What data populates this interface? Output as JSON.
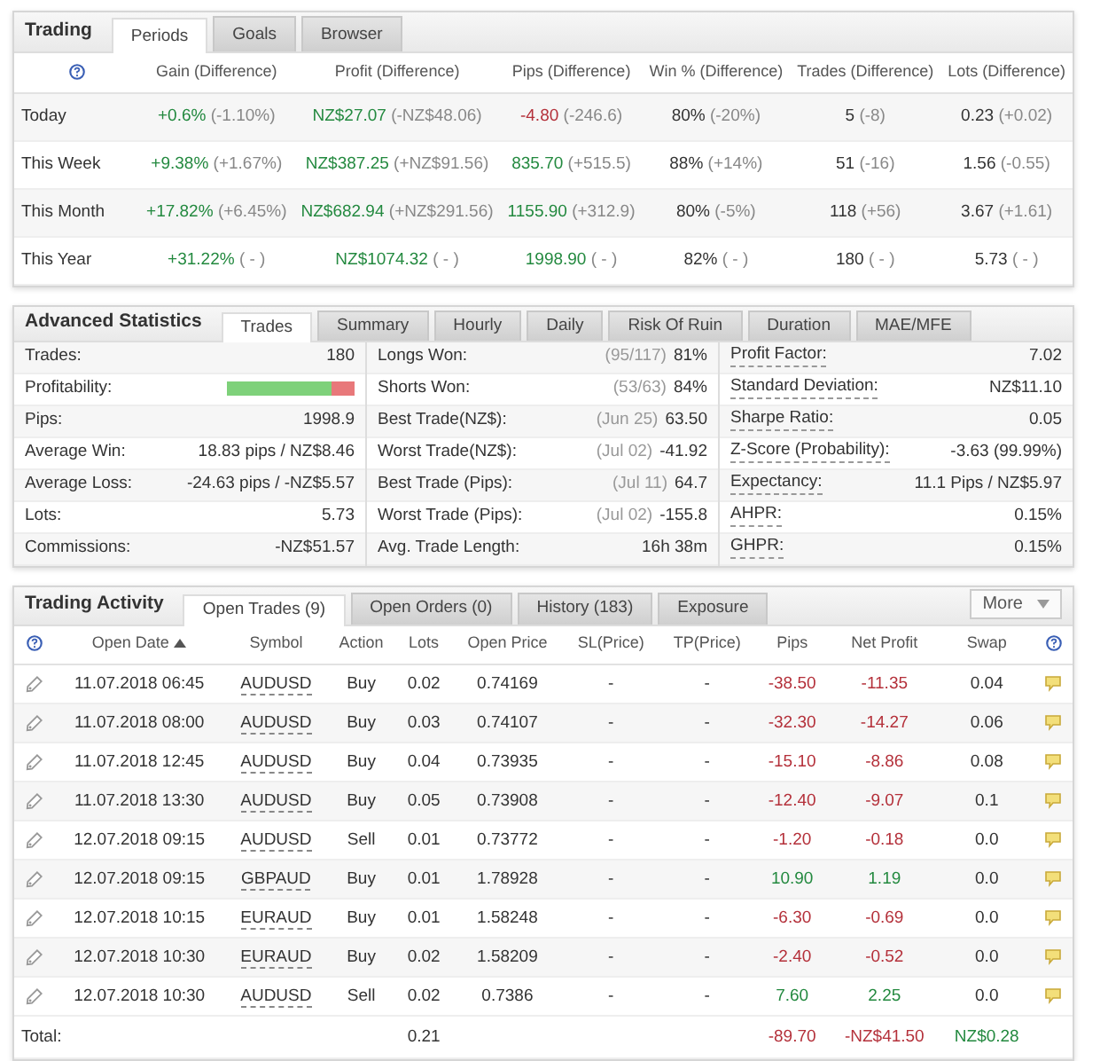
{
  "trading": {
    "title": "Trading",
    "tabs": [
      {
        "label": "Periods",
        "selected": true
      },
      {
        "label": "Goals",
        "selected": false
      },
      {
        "label": "Browser",
        "selected": false
      }
    ],
    "columns": [
      "Gain (Difference)",
      "Profit (Difference)",
      "Pips (Difference)",
      "Win % (Difference)",
      "Trades (Difference)",
      "Lots (Difference)"
    ],
    "rows": [
      {
        "period": "Today",
        "cells": [
          {
            "value": "+0.6%",
            "diff": "(-1.10%)",
            "color": "#23893f"
          },
          {
            "value": "NZ$27.07",
            "diff": "(-NZ$48.06)",
            "color": "#23893f"
          },
          {
            "value": "-4.80",
            "diff": "(-246.6)",
            "color": "#b4303a"
          },
          {
            "value": "80%",
            "diff": "(-20%)",
            "color": "#333333"
          },
          {
            "value": "5",
            "diff": "(-8)",
            "color": "#333333"
          },
          {
            "value": "0.23",
            "diff": "(+0.02)",
            "color": "#333333"
          }
        ]
      },
      {
        "period": "This Week",
        "cells": [
          {
            "value": "+9.38%",
            "diff": "(+1.67%)",
            "color": "#23893f"
          },
          {
            "value": "NZ$387.25",
            "diff": "(+NZ$91.56)",
            "color": "#23893f"
          },
          {
            "value": "835.70",
            "diff": "(+515.5)",
            "color": "#23893f"
          },
          {
            "value": "88%",
            "diff": "(+14%)",
            "color": "#333333"
          },
          {
            "value": "51",
            "diff": "(-16)",
            "color": "#333333"
          },
          {
            "value": "1.56",
            "diff": "(-0.55)",
            "color": "#333333"
          }
        ]
      },
      {
        "period": "This Month",
        "cells": [
          {
            "value": "+17.82%",
            "diff": "(+6.45%)",
            "color": "#23893f"
          },
          {
            "value": "NZ$682.94",
            "diff": "(+NZ$291.56)",
            "color": "#23893f"
          },
          {
            "value": "1155.90",
            "diff": "(+312.9)",
            "color": "#23893f"
          },
          {
            "value": "80%",
            "diff": "(-5%)",
            "color": "#333333"
          },
          {
            "value": "118",
            "diff": "(+56)",
            "color": "#333333"
          },
          {
            "value": "3.67",
            "diff": "(+1.61)",
            "color": "#333333"
          }
        ]
      },
      {
        "period": "This Year",
        "cells": [
          {
            "value": "+31.22%",
            "diff": "( - )",
            "color": "#23893f"
          },
          {
            "value": "NZ$1074.32",
            "diff": "( - )",
            "color": "#23893f"
          },
          {
            "value": "1998.90",
            "diff": "( - )",
            "color": "#23893f"
          },
          {
            "value": "82%",
            "diff": "( - )",
            "color": "#333333"
          },
          {
            "value": "180",
            "diff": "( - )",
            "color": "#333333"
          },
          {
            "value": "5.73",
            "diff": "( - )",
            "color": "#333333"
          }
        ]
      }
    ]
  },
  "advanced": {
    "title": "Advanced Statistics",
    "tabs": [
      {
        "label": "Trades",
        "selected": true
      },
      {
        "label": "Summary",
        "selected": false
      },
      {
        "label": "Hourly",
        "selected": false
      },
      {
        "label": "Daily",
        "selected": false
      },
      {
        "label": "Risk Of Ruin",
        "selected": false
      },
      {
        "label": "Duration",
        "selected": false
      },
      {
        "label": "MAE/MFE",
        "selected": false
      }
    ],
    "columns": [
      [
        {
          "label": "Trades:",
          "kind": "text",
          "value": "180"
        },
        {
          "label": "Profitability:",
          "kind": "bar",
          "level": 0.82
        },
        {
          "label": "Pips:",
          "kind": "text",
          "value": "1998.9"
        },
        {
          "label": "Average Win:",
          "kind": "text",
          "value": "18.83 pips / NZ$8.46"
        },
        {
          "label": "Average Loss:",
          "kind": "text",
          "value": "-24.63 pips / -NZ$5.57"
        },
        {
          "label": "Lots:",
          "kind": "text",
          "value": "5.73"
        },
        {
          "label": "Commissions:",
          "kind": "text",
          "value": "-NZ$51.57"
        }
      ],
      [
        {
          "label": "Longs Won:",
          "kind": "text",
          "note": "(95/117)",
          "value": "81%"
        },
        {
          "label": "Shorts Won:",
          "kind": "text",
          "note": "(53/63)",
          "value": "84%"
        },
        {
          "label": "Best Trade(NZ$):",
          "kind": "text",
          "note": "(Jun 25)",
          "value": "63.50"
        },
        {
          "label": "Worst Trade(NZ$):",
          "kind": "text",
          "note": "(Jul 02)",
          "value": "-41.92"
        },
        {
          "label": "Best Trade (Pips):",
          "kind": "text",
          "note": "(Jul 11)",
          "value": "64.7"
        },
        {
          "label": "Worst Trade (Pips):",
          "kind": "text",
          "note": "(Jul 02)",
          "value": "-155.8"
        },
        {
          "label": "Avg. Trade Length:",
          "kind": "text",
          "value": "16h 38m"
        }
      ],
      [
        {
          "label": "Profit Factor:",
          "kind": "text",
          "value": "7.02",
          "dotted": true
        },
        {
          "label": "Standard Deviation:",
          "kind": "text",
          "value": "NZ$11.10",
          "dotted": true
        },
        {
          "label": "Sharpe Ratio:",
          "kind": "text",
          "value": "0.05",
          "dotted": true
        },
        {
          "label": "Z-Score (Probability):",
          "kind": "text",
          "value": "-3.63 (99.99%)",
          "dotted": true
        },
        {
          "label": "Expectancy:",
          "kind": "text",
          "value": "11.1 Pips / NZ$5.97",
          "dotted": true
        },
        {
          "label": "AHPR:",
          "kind": "text",
          "value": "0.15%",
          "dotted": true
        },
        {
          "label": "GHPR:",
          "kind": "text",
          "value": "0.15%",
          "dotted": true
        }
      ]
    ]
  },
  "activity": {
    "title": "Trading Activity",
    "tabs": [
      {
        "label": "Open Trades (9)",
        "selected": true
      },
      {
        "label": "Open Orders (0)",
        "selected": false
      },
      {
        "label": "History (183)",
        "selected": false
      },
      {
        "label": "Exposure",
        "selected": false
      }
    ],
    "more": "More",
    "columns": [
      {
        "label": "Open Date",
        "sorted": true
      },
      {
        "label": "Symbol",
        "sorted": false
      },
      {
        "label": "Action",
        "sorted": false
      },
      {
        "label": "Lots",
        "sorted": false
      },
      {
        "label": "Open Price",
        "sorted": false
      },
      {
        "label": "SL(Price)",
        "sorted": false
      },
      {
        "label": "TP(Price)",
        "sorted": false
      },
      {
        "label": "Pips",
        "sorted": false
      },
      {
        "label": "Net Profit",
        "sorted": false
      },
      {
        "label": "Swap",
        "sorted": false
      }
    ],
    "rows": [
      {
        "date": "11.07.2018 06:45",
        "symbol": "AUDUSD",
        "action": "Buy",
        "lots": "0.02",
        "price": "0.74169",
        "sl": "-",
        "tp": "-",
        "pips": "-38.50",
        "profit": "-11.35",
        "swap": "0.04",
        "color": "#b4303a"
      },
      {
        "date": "11.07.2018 08:00",
        "symbol": "AUDUSD",
        "action": "Buy",
        "lots": "0.03",
        "price": "0.74107",
        "sl": "-",
        "tp": "-",
        "pips": "-32.30",
        "profit": "-14.27",
        "swap": "0.06",
        "color": "#b4303a"
      },
      {
        "date": "11.07.2018 12:45",
        "symbol": "AUDUSD",
        "action": "Buy",
        "lots": "0.04",
        "price": "0.73935",
        "sl": "-",
        "tp": "-",
        "pips": "-15.10",
        "profit": "-8.86",
        "swap": "0.08",
        "color": "#b4303a"
      },
      {
        "date": "11.07.2018 13:30",
        "symbol": "AUDUSD",
        "action": "Buy",
        "lots": "0.05",
        "price": "0.73908",
        "sl": "-",
        "tp": "-",
        "pips": "-12.40",
        "profit": "-9.07",
        "swap": "0.1",
        "color": "#b4303a"
      },
      {
        "date": "12.07.2018 09:15",
        "symbol": "AUDUSD",
        "action": "Sell",
        "lots": "0.01",
        "price": "0.73772",
        "sl": "-",
        "tp": "-",
        "pips": "-1.20",
        "profit": "-0.18",
        "swap": "0.0",
        "color": "#b4303a"
      },
      {
        "date": "12.07.2018 09:15",
        "symbol": "GBPAUD",
        "action": "Buy",
        "lots": "0.01",
        "price": "1.78928",
        "sl": "-",
        "tp": "-",
        "pips": "10.90",
        "profit": "1.19",
        "swap": "0.0",
        "color": "#23893f"
      },
      {
        "date": "12.07.2018 10:15",
        "symbol": "EURAUD",
        "action": "Buy",
        "lots": "0.01",
        "price": "1.58248",
        "sl": "-",
        "tp": "-",
        "pips": "-6.30",
        "profit": "-0.69",
        "swap": "0.0",
        "color": "#b4303a"
      },
      {
        "date": "12.07.2018 10:30",
        "symbol": "EURAUD",
        "action": "Buy",
        "lots": "0.02",
        "price": "1.58209",
        "sl": "-",
        "tp": "-",
        "pips": "-2.40",
        "profit": "-0.52",
        "swap": "0.0",
        "color": "#b4303a"
      },
      {
        "date": "12.07.2018 10:30",
        "symbol": "AUDUSD",
        "action": "Sell",
        "lots": "0.02",
        "price": "0.7386",
        "sl": "-",
        "tp": "-",
        "pips": "7.60",
        "profit": "2.25",
        "swap": "0.0",
        "color": "#23893f"
      }
    ],
    "total": {
      "label": "Total:",
      "lots": "0.21",
      "pips": {
        "value": "-89.70",
        "color": "#b4303a"
      },
      "profit": {
        "value": "-NZ$41.50",
        "color": "#b4303a"
      },
      "swap": {
        "value": "NZ$0.28",
        "color": "#23893f"
      }
    }
  }
}
